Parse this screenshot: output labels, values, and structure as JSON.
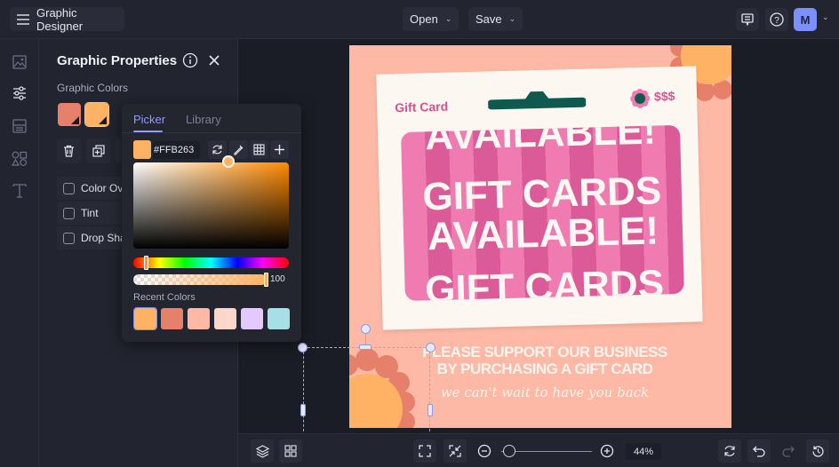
{
  "app": {
    "title": "Graphic Designer"
  },
  "topbar": {
    "open_label": "Open",
    "save_label": "Save",
    "avatar_initial": "M",
    "icons": [
      "menu-icon",
      "chevron-down-icon",
      "comment-icon",
      "help-icon"
    ]
  },
  "rail": {
    "items": [
      "image",
      "adjustments",
      "layout",
      "shapes",
      "text"
    ]
  },
  "panel": {
    "title": "Graphic Properties",
    "colors_label": "Graphic Colors",
    "colors": [
      "#e6806a",
      "#ffb263"
    ],
    "options": [
      {
        "label": "Color Overlay",
        "checked": false
      },
      {
        "label": "Tint",
        "checked": false
      },
      {
        "label": "Drop Shadow",
        "checked": false
      }
    ]
  },
  "picker": {
    "tabs": [
      {
        "label": "Picker",
        "active": true
      },
      {
        "label": "Library",
        "active": false
      }
    ],
    "hex": "#FFB263",
    "current_color": "#ffb263",
    "opacity": "100",
    "recent_label": "Recent Colors",
    "recent_colors": [
      "#ffb263",
      "#e6806a",
      "#fdb8a6",
      "#ffd6cc",
      "#e3c9ff",
      "#a7dfe6"
    ]
  },
  "design": {
    "tag": "Gift Card",
    "price": "$$$",
    "card_lines": [
      "AVAILABLE!",
      "GIFT CARDS",
      "AVAILABLE!",
      "GIFT CARDS"
    ],
    "support_line1": "PLEASE SUPPORT OUR BUSINESS",
    "support_line2": "BY PURCHASING A GIFT CARD",
    "script": "we can't wait to have you back",
    "colors": {
      "bg": "#fdb8a6",
      "card": "#fcf7f0",
      "stripe_a": "#f07bb0",
      "stripe_b": "#da5b97",
      "accent": "#0f5a4e",
      "flower_center": "#ffb263",
      "petal": "#e6806a",
      "tag": "#d94f8c"
    }
  },
  "bottombar": {
    "zoom": "44%"
  }
}
